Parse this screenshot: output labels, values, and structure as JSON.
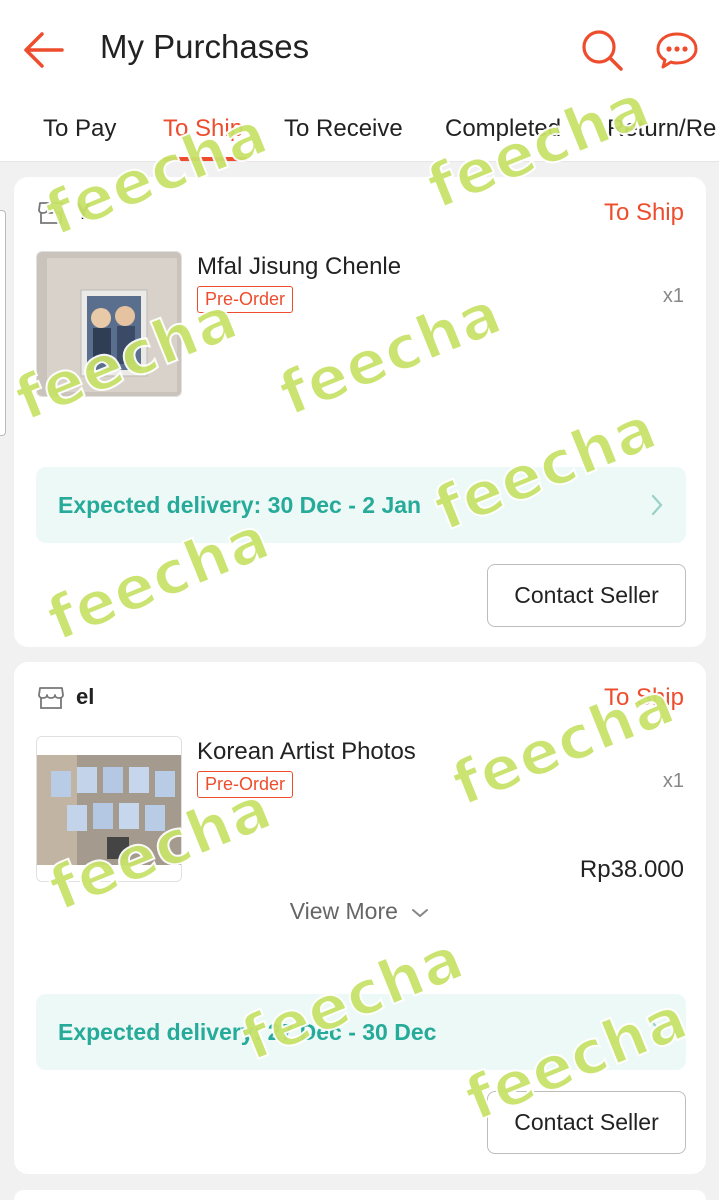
{
  "header": {
    "title": "My Purchases",
    "back_icon": "arrow-left-icon",
    "search_icon": "search-icon",
    "chat_icon": "chat-icon",
    "accent_color": "#ee4d2d"
  },
  "tabs": [
    {
      "label": "To Pay",
      "active": false
    },
    {
      "label": "To Ship",
      "active": true
    },
    {
      "label": "To Receive",
      "active": false
    },
    {
      "label": "Completed",
      "active": false
    },
    {
      "label": "Return/Re",
      "active": false
    }
  ],
  "orders": [
    {
      "shop_name": "Y",
      "status": "To Ship",
      "product_name": "Mfal Jisung Chenle",
      "badge": "Pre-Order",
      "quantity": "x1",
      "delivery": "Expected delivery: 30 Dec - 2 Jan",
      "action": "Contact Seller"
    },
    {
      "shop_name": "el",
      "status": "To Ship",
      "product_name": "Korean Artist Photos",
      "badge": "Pre-Order",
      "quantity": "x1",
      "price": "Rp38.000",
      "view_more": "View More",
      "delivery": "Expected delivery: 27 Dec - 30 Dec",
      "action": "Contact Seller"
    }
  ],
  "watermark": "feecha",
  "colors": {
    "accent": "#ee4d2d",
    "delivery_text": "#26aa99",
    "delivery_bg": "#ecf9f6",
    "watermark": "#c8e26a"
  }
}
